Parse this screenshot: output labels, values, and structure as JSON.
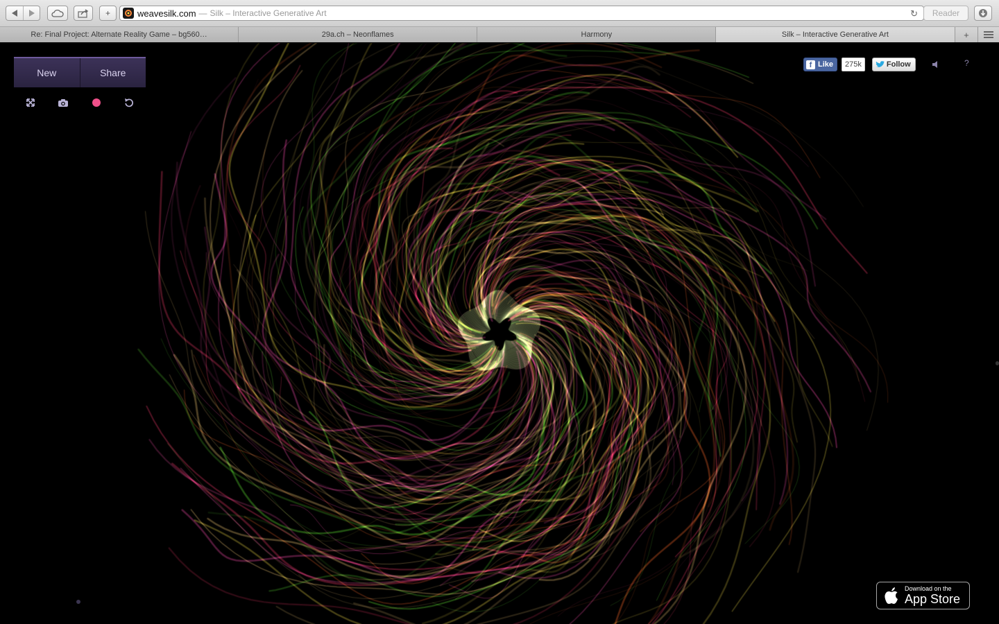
{
  "browser": {
    "url_domain": "weavesilk.com",
    "url_separator": "—",
    "page_title": "Silk – Interactive Generative Art",
    "reader_label": "Reader",
    "new_tab_symbol": "+"
  },
  "tabs": [
    {
      "label": "Re: Final Project: Alternate Reality Game – bg560…",
      "active": false
    },
    {
      "label": "29a.ch – Neonflames",
      "active": false
    },
    {
      "label": "Harmony",
      "active": false
    },
    {
      "label": "Silk – Interactive Generative Art",
      "active": true
    }
  ],
  "controls": {
    "new_label": "New",
    "share_label": "Share",
    "icons": [
      "fullscreen-icon",
      "camera-icon",
      "color-dot-icon",
      "undo-icon"
    ],
    "accent_color": "#f0508a"
  },
  "social": {
    "like_label": "Like",
    "like_count": "275k",
    "follow_label": "Follow",
    "help_label": "?"
  },
  "appstore": {
    "small": "Download on the",
    "big": "App Store"
  },
  "art": {
    "palette": [
      "#ff3d6e",
      "#ff6a2a",
      "#ffe84a",
      "#6cff3a",
      "#ff4fb0",
      "#ffd27a"
    ]
  }
}
